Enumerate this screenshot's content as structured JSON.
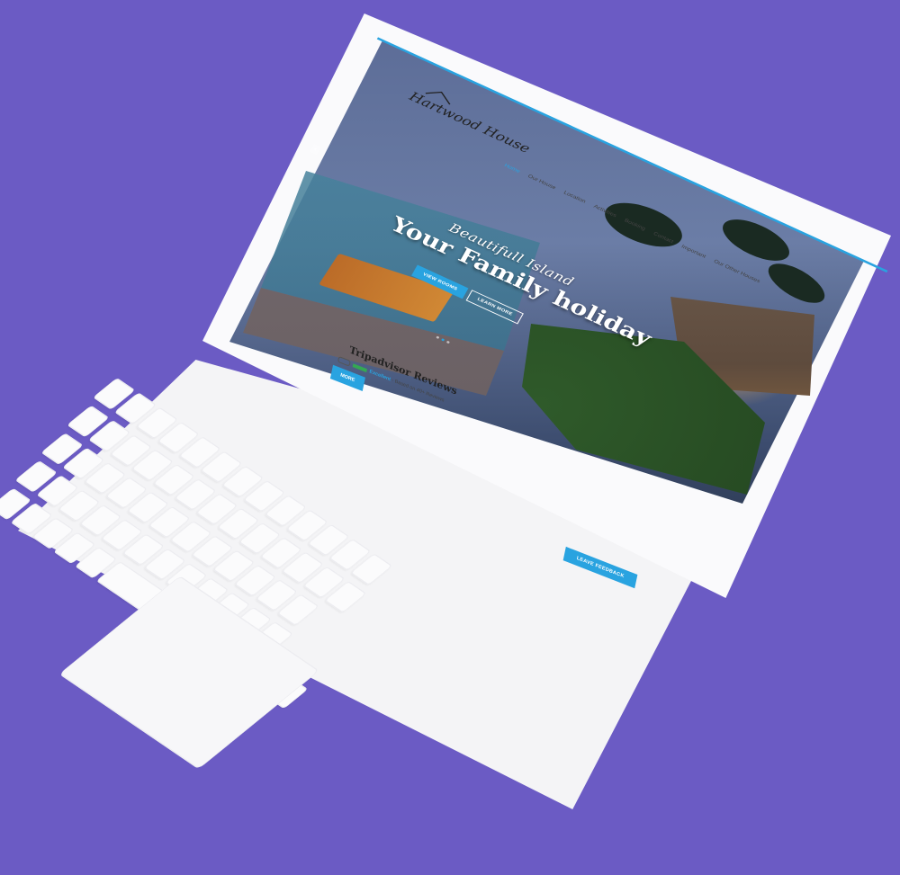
{
  "site": {
    "logo_text": "Hartwood House",
    "nav": [
      {
        "label": "Home",
        "active": true
      },
      {
        "label": "Our House",
        "active": false
      },
      {
        "label": "Location",
        "active": false
      },
      {
        "label": "Activities",
        "active": false
      },
      {
        "label": "Booking",
        "active": false
      },
      {
        "label": "Contact",
        "active": false
      },
      {
        "label": "Important",
        "active": false
      },
      {
        "label": "Our Other Houses",
        "active": false
      }
    ],
    "hero": {
      "subtitle": "Beautifull Island",
      "title": "Your Family holiday",
      "primary_button": "VIEW ROOMS",
      "secondary_button": "LEARN MORE",
      "slide_count": 3,
      "active_slide": 2,
      "prev_arrow": "‹"
    },
    "reviews": {
      "title": "Tripadvisor Reviews",
      "rating_label": "Excellent",
      "rating_note": "Based on 40+ Reviews",
      "more_button": "MORE",
      "feedback_button": "LEAVE FEEDBACK"
    }
  },
  "colors": {
    "background": "#6b5bc4",
    "accent": "#29a3e0",
    "laptop_body": "#f4f4f6"
  }
}
